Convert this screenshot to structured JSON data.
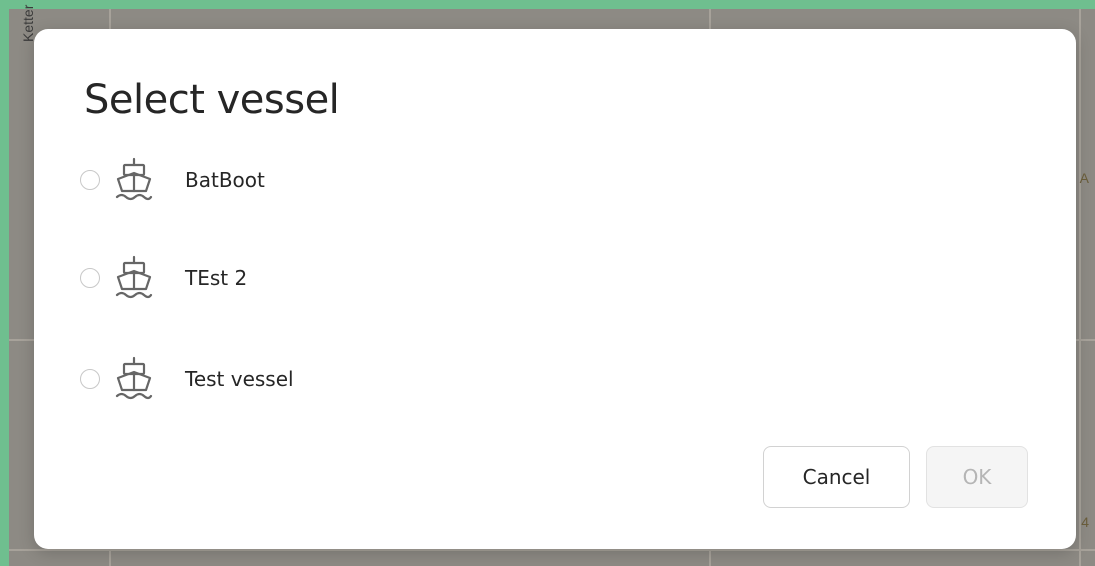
{
  "map": {
    "side_label": "Ketter",
    "edge_letter": "A",
    "edge_letter_bottom": "4"
  },
  "dialog": {
    "title": "Select vessel",
    "options": [
      {
        "label": "BatBoot",
        "icon": "ship-icon",
        "selected": false
      },
      {
        "label": "TEst 2",
        "icon": "ship-icon",
        "selected": false
      },
      {
        "label": "Test vessel",
        "icon": "ship-icon",
        "selected": false
      }
    ],
    "cancel_label": "Cancel",
    "ok_label": "OK",
    "ok_disabled": true
  },
  "colors": {
    "frame_accent": "#6fbf8f",
    "dialog_bg": "#ffffff",
    "text": "#262626",
    "disabled_text": "#b5b5b5"
  }
}
